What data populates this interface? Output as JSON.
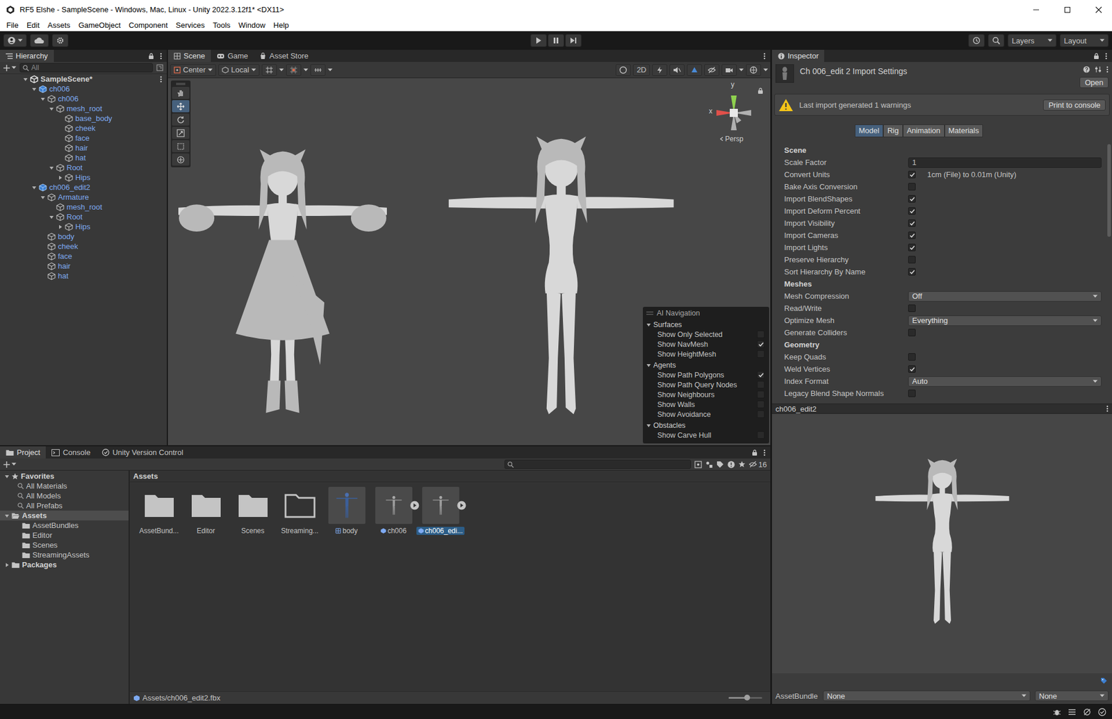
{
  "window": {
    "title": "RF5 Elshe - SampleScene - Windows, Mac, Linux - Unity 2022.3.12f1* <DX11>"
  },
  "menu": [
    "File",
    "Edit",
    "Assets",
    "GameObject",
    "Component",
    "Services",
    "Tools",
    "Window",
    "Help"
  ],
  "toolbar": {
    "layers": "Layers",
    "layout": "Layout"
  },
  "hierarchy": {
    "title": "Hierarchy",
    "search_placeholder": "All",
    "items": [
      {
        "label": "SampleScene*",
        "depth": 0,
        "kind": "scene",
        "foldout": true,
        "expanded": true
      },
      {
        "label": "ch006",
        "depth": 1,
        "kind": "prefab",
        "foldout": true,
        "expanded": true
      },
      {
        "label": "ch006",
        "depth": 2,
        "kind": "child",
        "foldout": true,
        "expanded": true
      },
      {
        "label": "mesh_root",
        "depth": 3,
        "kind": "child",
        "foldout": true,
        "expanded": true
      },
      {
        "label": "base_body",
        "depth": 4,
        "kind": "child",
        "foldout": false,
        "expanded": false
      },
      {
        "label": "cheek",
        "depth": 4,
        "kind": "child",
        "foldout": false,
        "expanded": false
      },
      {
        "label": "face",
        "depth": 4,
        "kind": "child",
        "foldout": false,
        "expanded": false
      },
      {
        "label": "hair",
        "depth": 4,
        "kind": "child",
        "foldout": false,
        "expanded": false
      },
      {
        "label": "hat",
        "depth": 4,
        "kind": "child",
        "foldout": false,
        "expanded": false
      },
      {
        "label": "Root",
        "depth": 3,
        "kind": "child",
        "foldout": true,
        "expanded": true
      },
      {
        "label": "Hips",
        "depth": 4,
        "kind": "child",
        "foldout": true,
        "expanded": false
      },
      {
        "label": "ch006_edit2",
        "depth": 1,
        "kind": "prefab",
        "foldout": true,
        "expanded": true
      },
      {
        "label": "Armature",
        "depth": 2,
        "kind": "child",
        "foldout": true,
        "expanded": true
      },
      {
        "label": "mesh_root",
        "depth": 3,
        "kind": "child",
        "foldout": false,
        "expanded": false
      },
      {
        "label": "Root",
        "depth": 3,
        "kind": "child",
        "foldout": true,
        "expanded": true
      },
      {
        "label": "Hips",
        "depth": 4,
        "kind": "child",
        "foldout": true,
        "expanded": false
      },
      {
        "label": "body",
        "depth": 2,
        "kind": "child",
        "foldout": false,
        "expanded": false
      },
      {
        "label": "cheek",
        "depth": 2,
        "kind": "child",
        "foldout": false,
        "expanded": false
      },
      {
        "label": "face",
        "depth": 2,
        "kind": "child",
        "foldout": false,
        "expanded": false
      },
      {
        "label": "hair",
        "depth": 2,
        "kind": "child",
        "foldout": false,
        "expanded": false
      },
      {
        "label": "hat",
        "depth": 2,
        "kind": "child",
        "foldout": false,
        "expanded": false
      }
    ]
  },
  "scene": {
    "tabs": [
      {
        "label": "Scene",
        "selected": true
      },
      {
        "label": "Game",
        "selected": false
      },
      {
        "label": "Asset Store",
        "selected": false
      }
    ],
    "pivot": "Center",
    "space": "Local",
    "mode_2d": "2D",
    "axis_y": "y",
    "axis_x": "x",
    "projection": "Persp",
    "tools": [
      {
        "selected": false
      },
      {
        "selected": true
      },
      {
        "selected": false
      },
      {
        "selected": false
      },
      {
        "selected": false
      },
      {
        "selected": false
      }
    ]
  },
  "ai_navigation": {
    "title": "AI Navigation",
    "sections": [
      {
        "label": "Surfaces",
        "expanded": true,
        "items": [
          {
            "label": "Show Only Selected",
            "checked": false
          },
          {
            "label": "Show NavMesh",
            "checked": true
          },
          {
            "label": "Show HeightMesh",
            "checked": false
          }
        ]
      },
      {
        "label": "Agents",
        "expanded": true,
        "items": [
          {
            "label": "Show Path Polygons",
            "checked": true
          },
          {
            "label": "Show Path Query Nodes",
            "checked": false
          },
          {
            "label": "Show Neighbours",
            "checked": false
          },
          {
            "label": "Show Walls",
            "checked": false
          },
          {
            "label": "Show Avoidance",
            "checked": false
          }
        ]
      },
      {
        "label": "Obstacles",
        "expanded": true,
        "items": [
          {
            "label": "Show Carve Hull",
            "checked": false
          }
        ]
      }
    ]
  },
  "inspector": {
    "tab": "Inspector",
    "header": "Ch 006_edit 2 Import Settings",
    "open": "Open",
    "warning": "Last import generated 1 warnings",
    "print": "Print to console",
    "tabs": [
      {
        "label": "Model",
        "selected": true
      },
      {
        "label": "Rig",
        "selected": false
      },
      {
        "label": "Animation",
        "selected": false
      },
      {
        "label": "Materials",
        "selected": false
      }
    ],
    "properties": [
      {
        "kind": "header",
        "label": "Scene"
      },
      {
        "kind": "text",
        "label": "Scale Factor",
        "value": "1"
      },
      {
        "kind": "checkbox",
        "label": "Convert Units",
        "checked": true,
        "note": "1cm (File) to 0.01m (Unity)"
      },
      {
        "kind": "checkbox",
        "label": "Bake Axis Conversion",
        "checked": false
      },
      {
        "kind": "checkbox",
        "label": "Import BlendShapes",
        "checked": true
      },
      {
        "kind": "checkbox",
        "label": "Import Deform Percent",
        "checked": true
      },
      {
        "kind": "checkbox",
        "label": "Import Visibility",
        "checked": true
      },
      {
        "kind": "checkbox",
        "label": "Import Cameras",
        "checked": true
      },
      {
        "kind": "checkbox",
        "label": "Import Lights",
        "checked": true
      },
      {
        "kind": "checkbox",
        "label": "Preserve Hierarchy",
        "checked": false
      },
      {
        "kind": "checkbox",
        "label": "Sort Hierarchy By Name",
        "checked": true
      },
      {
        "kind": "header",
        "label": "Meshes"
      },
      {
        "kind": "dropdown",
        "label": "Mesh Compression",
        "value": "Off"
      },
      {
        "kind": "checkbox",
        "label": "Read/Write",
        "checked": false
      },
      {
        "kind": "dropdown",
        "label": "Optimize Mesh",
        "value": "Everything"
      },
      {
        "kind": "checkbox",
        "label": "Generate Colliders",
        "checked": false
      },
      {
        "kind": "header",
        "label": "Geometry"
      },
      {
        "kind": "checkbox",
        "label": "Keep Quads",
        "checked": false
      },
      {
        "kind": "checkbox",
        "label": "Weld Vertices",
        "checked": true
      },
      {
        "kind": "dropdown",
        "label": "Index Format",
        "value": "Auto"
      },
      {
        "kind": "checkbox",
        "label": "Legacy Blend Shape Normals",
        "checked": false
      }
    ],
    "preview_title": "ch006_edit2",
    "assetbundle": {
      "label": "AssetBundle",
      "name": "None",
      "variant": "None"
    }
  },
  "project": {
    "tabs": [
      {
        "label": "Project",
        "selected": true
      },
      {
        "label": "Console",
        "selected": false
      },
      {
        "label": "Unity Version Control",
        "selected": false
      }
    ],
    "hidden_count": "16",
    "favorites": {
      "label": "Favorites",
      "expanded": true,
      "items": [
        "All Materials",
        "All Models",
        "All Prefabs"
      ]
    },
    "tree": [
      {
        "label": "Assets",
        "depth": 0,
        "foldout": true,
        "expanded": true,
        "selected": true
      },
      {
        "label": "AssetBundles",
        "depth": 1,
        "foldout": false,
        "expanded": false,
        "selected": false
      },
      {
        "label": "Editor",
        "depth": 1,
        "foldout": false,
        "expanded": false,
        "selected": false
      },
      {
        "label": "Scenes",
        "depth": 1,
        "foldout": false,
        "expanded": false,
        "selected": false
      },
      {
        "label": "StreamingAssets",
        "depth": 1,
        "foldout": false,
        "expanded": false,
        "selected": false
      },
      {
        "label": "Packages",
        "depth": 0,
        "foldout": true,
        "expanded": false,
        "selected": false
      }
    ],
    "breadcrumb": "Assets",
    "assets": [
      {
        "label": "AssetBund...",
        "kind": "folder",
        "selected": false
      },
      {
        "label": "Editor",
        "kind": "folder",
        "selected": false
      },
      {
        "label": "Scenes",
        "kind": "folder",
        "selected": false
      },
      {
        "label": "Streaming...",
        "kind": "empty-folder",
        "selected": false
      },
      {
        "label": "body",
        "kind": "mesh",
        "selected": false
      },
      {
        "label": "ch006",
        "kind": "model",
        "selected": false
      },
      {
        "label": "ch006_edi...",
        "kind": "model",
        "selected": true
      }
    ],
    "path": "Assets/ch006_edit2.fbx",
    "zoom": {
      "level": 0.56
    }
  }
}
